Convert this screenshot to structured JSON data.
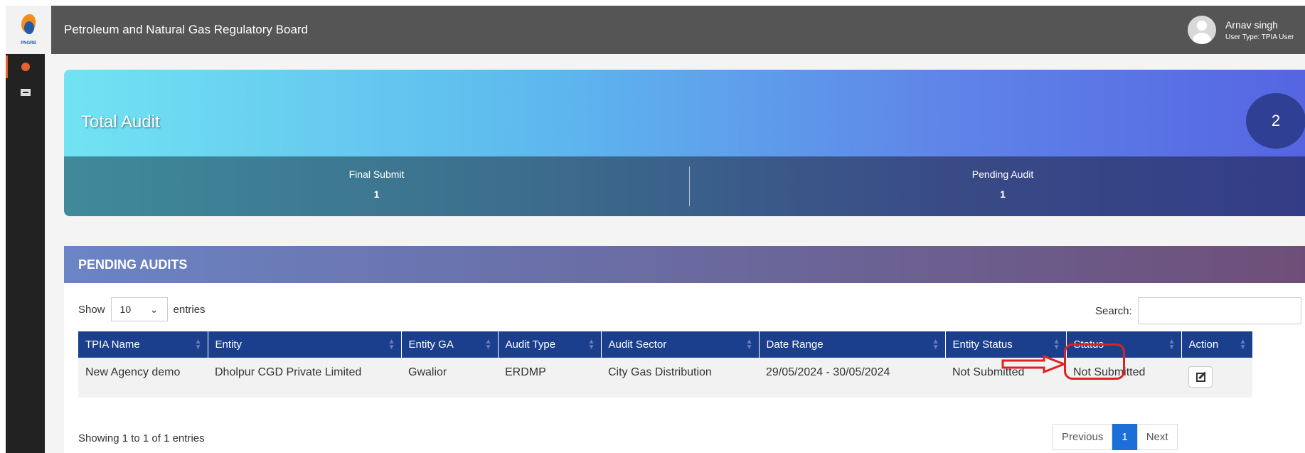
{
  "header": {
    "logo_text": "PNGRB",
    "app_title": "Petroleum and Natural Gas Regulatory Board",
    "user_name": "Arnav singh",
    "user_type": "User Type: TPIA User"
  },
  "sidebar": {
    "items": [
      {
        "name": "dashboard",
        "icon": "dashboard-icon",
        "active": true
      },
      {
        "name": "list",
        "icon": "list-icon",
        "active": false
      }
    ]
  },
  "stats": {
    "title": "Total Audit",
    "total": "2",
    "final_submit_label": "Final Submit",
    "final_submit_value": "1",
    "pending_audit_label": "Pending Audit",
    "pending_audit_value": "1"
  },
  "pending": {
    "title": "PENDING AUDITS",
    "show_label": "Show",
    "entries_label": "entries",
    "page_size": "10",
    "search_label": "Search:",
    "columns": [
      "TPIA Name",
      "Entity",
      "Entity GA",
      "Audit Type",
      "Audit Sector",
      "Date Range",
      "Entity Status",
      "Status",
      "Action"
    ],
    "rows": [
      {
        "tpia_name": "New Agency demo",
        "entity": "Dholpur CGD Private Limited",
        "entity_ga": "Gwalior",
        "audit_type": "ERDMP",
        "audit_sector": "City Gas Distribution",
        "date_range": "29/05/2024 - 30/05/2024",
        "entity_status": "Not Submitted",
        "status": "Not Submitted"
      }
    ],
    "info": "Showing 1 to 1 of 1 entries",
    "prev_label": "Previous",
    "current_page": "1",
    "next_label": "Next"
  },
  "colors": {
    "accent": "#e8602c",
    "table_header": "#1b3f8d",
    "annotation": "#dd2222"
  }
}
